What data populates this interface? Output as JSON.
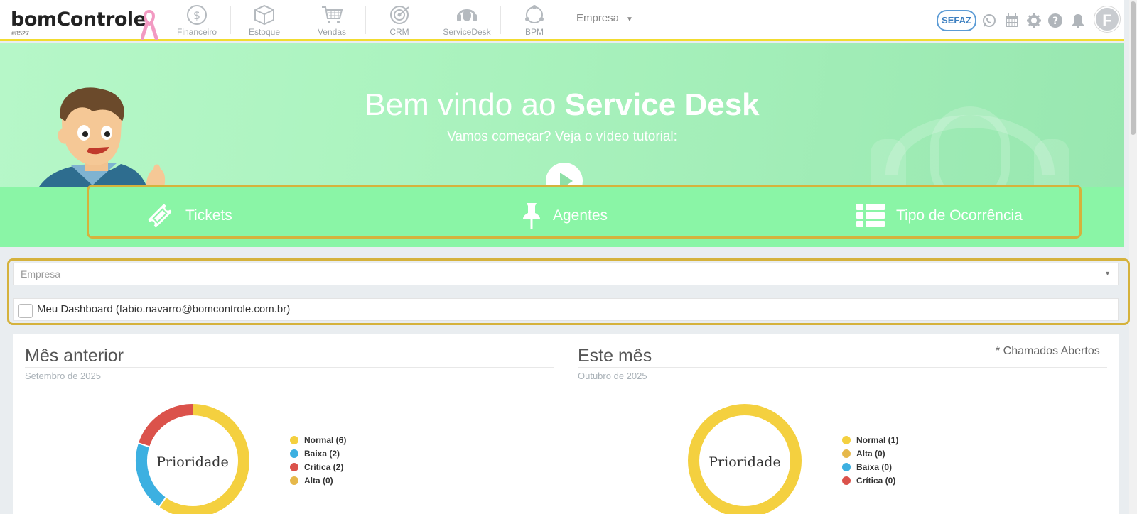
{
  "brand": {
    "name": "bomControle",
    "account_id": "#8527"
  },
  "nav": {
    "items": [
      {
        "label": "Financeiro",
        "icon": "dollar-icon"
      },
      {
        "label": "Estoque",
        "icon": "box-icon"
      },
      {
        "label": "Vendas",
        "icon": "cart-icon"
      },
      {
        "label": "CRM",
        "icon": "target-icon"
      },
      {
        "label": "ServiceDesk",
        "icon": "headset-icon"
      },
      {
        "label": "BPM",
        "icon": "process-icon"
      }
    ],
    "empresa_label": "Empresa",
    "sefaz_label": "SEFAZ",
    "avatar_initial": "F"
  },
  "hero": {
    "title_prefix": "Bem vindo ao ",
    "title_bold": "Service Desk",
    "subtitle": "Vamos começar? Veja o vídeo tutorial:"
  },
  "tabs": [
    {
      "label": "Tickets",
      "icon": "ticket-icon"
    },
    {
      "label": "Agentes",
      "icon": "pin-icon"
    },
    {
      "label": "Tipo de Ocorrência",
      "icon": "list-icon"
    }
  ],
  "filters": {
    "empresa_placeholder": "Empresa",
    "dashboard_label": "Meu Dashboard (fabio.navarro@bomcontrole.com.br)",
    "dashboard_checked": false
  },
  "dashboard": {
    "chamados_note": "* Chamados Abertos",
    "previous": {
      "title": "Mês anterior",
      "period": "Setembro de 2025",
      "chart_label": "Prioridade",
      "legend": [
        {
          "label": "Normal (6)",
          "color": "#f4d03f"
        },
        {
          "label": "Baixa (2)",
          "color": "#3cb0e1"
        },
        {
          "label": "Crítica (2)",
          "color": "#db524b"
        },
        {
          "label": "Alta (0)",
          "color": "#e6b84a"
        }
      ]
    },
    "current": {
      "title": "Este mês",
      "period": "Outubro de 2025",
      "chart_label": "Prioridade",
      "legend": [
        {
          "label": "Normal (1)",
          "color": "#f4d03f"
        },
        {
          "label": "Alta (0)",
          "color": "#e6b84a"
        },
        {
          "label": "Baixa (0)",
          "color": "#3cb0e1"
        },
        {
          "label": "Crítica (0)",
          "color": "#db524b"
        }
      ]
    }
  },
  "chart_data": [
    {
      "type": "pie",
      "categories": [
        "Normal",
        "Baixa",
        "Crítica",
        "Alta"
      ],
      "values": [
        6,
        2,
        2,
        0
      ],
      "colors": [
        "#f4d03f",
        "#3cb0e1",
        "#db524b",
        "#e6b84a"
      ]
    },
    {
      "type": "pie",
      "categories": [
        "Normal",
        "Alta",
        "Baixa",
        "Crítica"
      ],
      "values": [
        1,
        0,
        0,
        0
      ],
      "colors": [
        "#f4d03f",
        "#e6b84a",
        "#3cb0e1",
        "#db524b"
      ]
    }
  ]
}
